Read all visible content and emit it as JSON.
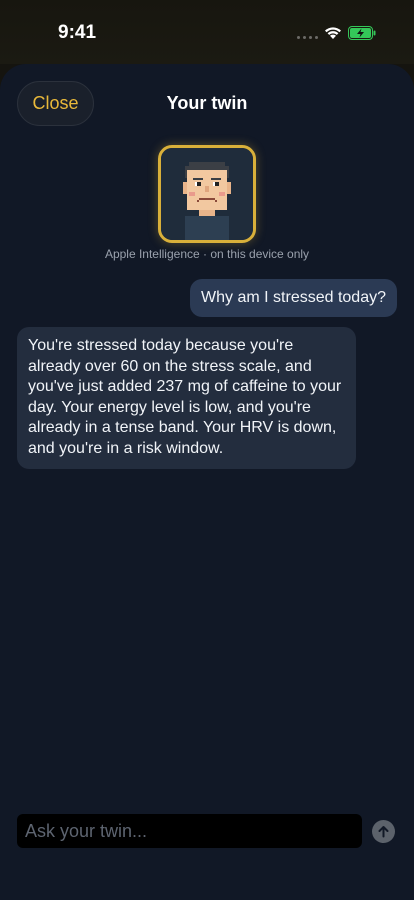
{
  "status_bar": {
    "time": "9:41",
    "icons": [
      "signal-dots-icon",
      "wifi-icon",
      "battery-charging-icon"
    ],
    "battery_color": "#34c759"
  },
  "header": {
    "close_label": "Close",
    "title": "Your twin"
  },
  "avatar": {
    "icon": "pixel-face-avatar-icon",
    "frame_color": "#d9b03a"
  },
  "ai_caption": "Apple Intelligence · on this device only",
  "messages": [
    {
      "role": "user",
      "text": "Why am I stressed today?"
    },
    {
      "role": "assistant",
      "text": "You're stressed today because you're already over 60 on the stress scale, and you've just added 237 mg of caffeine to your day. Your energy level is low, and you're already in a tense band. Your HRV is down, and you're in a risk window."
    }
  ],
  "composer": {
    "placeholder": "Ask your twin...",
    "value": "",
    "send_icon": "arrow-up-icon"
  },
  "colors": {
    "accent": "#e9b93a",
    "sheet_background": "#111826",
    "user_bubble": "#2b3a54",
    "assistant_bubble": "#232d3e"
  }
}
